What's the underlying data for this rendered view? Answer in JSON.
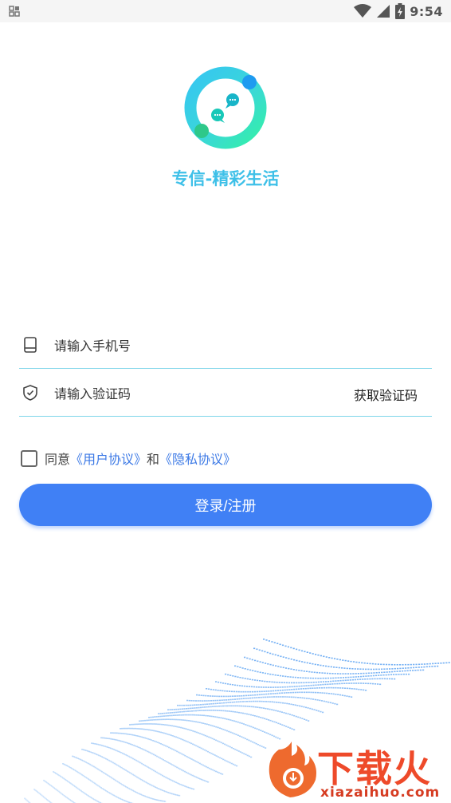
{
  "status_bar": {
    "time": "9:54",
    "left_icon": "notification-grid-icon",
    "icons": [
      "wifi-icon",
      "signal-icon",
      "battery-charging-icon"
    ]
  },
  "app": {
    "title": "专信-精彩生活",
    "logo_icon": "chat-bubbles-ring-logo"
  },
  "login_form": {
    "phone": {
      "placeholder": "请输入手机号",
      "value": "",
      "icon": "phone-icon"
    },
    "code": {
      "placeholder": "请输入验证码",
      "value": "",
      "icon": "shield-check-icon",
      "get_code_label": "获取验证码"
    },
    "agreement": {
      "checked": false,
      "prefix": "同意",
      "user_agreement": "《用户协议》",
      "conjunction": "和",
      "privacy_agreement": "《隐私协议》"
    },
    "submit_label": "登录/注册"
  },
  "watermark": {
    "text": "下载火",
    "domain": "xiazaihuo.com"
  },
  "colors": {
    "accent": "#4080f5",
    "title": "#3ec0e8",
    "link": "#3d7ae6",
    "underline": "#7fd6ea"
  }
}
